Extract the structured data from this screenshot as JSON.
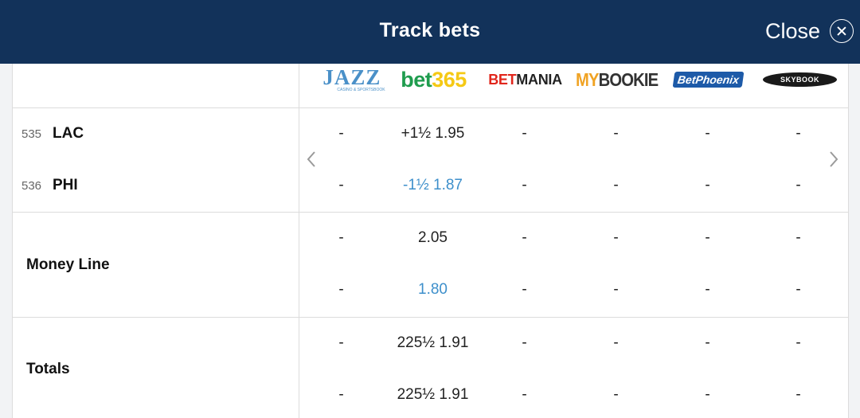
{
  "header": {
    "title": "Track bets",
    "close_label": "Close"
  },
  "bookmakers": [
    {
      "name": "JAZZ",
      "sub": "CASINO & SPORTSBOOK"
    },
    {
      "name": "bet365"
    },
    {
      "name": "BETMANIA"
    },
    {
      "name": "MYBOOKIE"
    },
    {
      "name": "BetPhoenix"
    },
    {
      "name": "SKYBOOK"
    }
  ],
  "spread": {
    "teams": [
      {
        "rot": "535",
        "team": "LAC",
        "odds": [
          "-",
          "+1½ 1.95",
          "-",
          "-",
          "-",
          "-"
        ]
      },
      {
        "rot": "536",
        "team": "PHI",
        "odds": [
          "-",
          "-1½ 1.87",
          "-",
          "-",
          "-",
          "-"
        ]
      }
    ]
  },
  "moneyline": {
    "label": "Money Line",
    "rows": [
      [
        "-",
        "2.05",
        "-",
        "-",
        "-",
        "-"
      ],
      [
        "-",
        "1.80",
        "-",
        "-",
        "-",
        "-"
      ]
    ]
  },
  "totals": {
    "label": "Totals",
    "rows": [
      [
        "-",
        "225½ 1.91",
        "-",
        "-",
        "-",
        "-"
      ],
      [
        "-",
        "225½ 1.91",
        "-",
        "-",
        "-",
        "-"
      ]
    ]
  },
  "colors": {
    "header_bg": "#12325a",
    "highlight": "#3d8fcb"
  }
}
